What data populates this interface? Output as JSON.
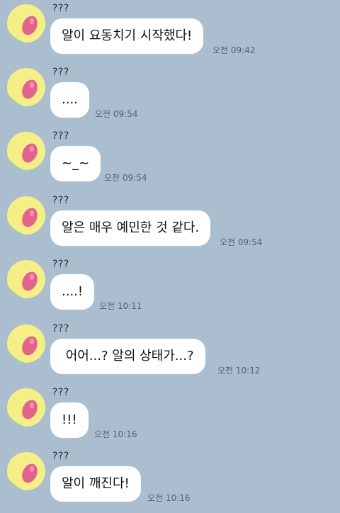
{
  "theme": {
    "background": "#abbed0",
    "bubble": "#ffffff",
    "avatar_yellow": "#f6ee86",
    "avatar_pink": "#e2638b",
    "avatar_green": "#84d9a0"
  },
  "avatar_icon": "egg-avatar-icon",
  "messages": [
    {
      "sender": "???",
      "text": "알이 요동치기 시작했다!",
      "time": "오전 09:42"
    },
    {
      "sender": "???",
      "text": "....",
      "time": "오전 09:54"
    },
    {
      "sender": "???",
      "text": "~_~",
      "time": "오전 09:54"
    },
    {
      "sender": "???",
      "text": "알은 매우 예민한 것 같다.",
      "time": "오전 09:54"
    },
    {
      "sender": "???",
      "text": "....!",
      "time": "오전 10:11"
    },
    {
      "sender": "???",
      "text": " 어어...? 알의 상태가...?",
      "time": "오전 10:12"
    },
    {
      "sender": "???",
      "text": "!!!",
      "time": "오전 10:16"
    },
    {
      "sender": "???",
      "text": "알이 깨진다!",
      "time": "오전 10:16"
    }
  ]
}
